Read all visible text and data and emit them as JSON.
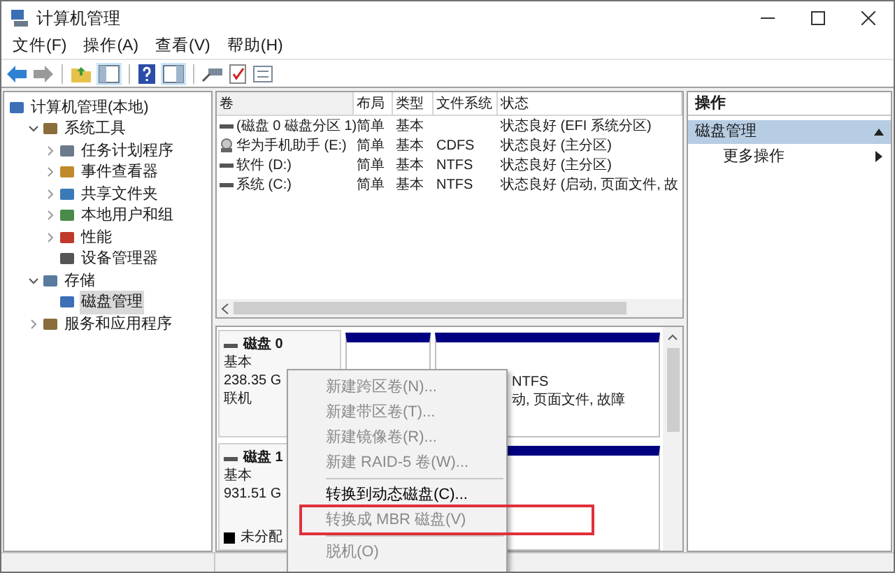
{
  "window": {
    "title": "计算机管理"
  },
  "menu": [
    "文件(F)",
    "操作(A)",
    "查看(V)",
    "帮助(H)"
  ],
  "tree": [
    {
      "label": "计算机管理(本地)",
      "selected": false,
      "children": [
        {
          "label": "系统工具",
          "expanded": true,
          "selected": false,
          "children": [
            {
              "label": "任务计划程序",
              "expanded": false,
              "selected": false
            },
            {
              "label": "事件查看器",
              "expanded": false,
              "selected": false
            },
            {
              "label": "共享文件夹",
              "expanded": false,
              "selected": false
            },
            {
              "label": "本地用户和组",
              "expanded": false,
              "selected": false
            },
            {
              "label": "性能",
              "expanded": false,
              "selected": false
            },
            {
              "label": "设备管理器",
              "selected": false
            }
          ]
        },
        {
          "label": "存储",
          "expanded": true,
          "selected": false,
          "children": [
            {
              "label": "磁盘管理",
              "selected": true
            }
          ]
        },
        {
          "label": "服务和应用程序",
          "expanded": false,
          "selected": false
        }
      ]
    }
  ],
  "volumes": {
    "columns": [
      "卷",
      "布局",
      "类型",
      "文件系统",
      "状态"
    ],
    "rows": [
      {
        "kind": "disk",
        "cells": [
          "(磁盘 0 磁盘分区 1)",
          "简单",
          "基本",
          "",
          "状态良好 (EFI 系统分区)"
        ]
      },
      {
        "kind": "cd",
        "cells": [
          "华为手机助手 (E:)",
          "简单",
          "基本",
          "CDFS",
          "状态良好 (主分区)"
        ]
      },
      {
        "kind": "disk",
        "cells": [
          "软件 (D:)",
          "简单",
          "基本",
          "NTFS",
          "状态良好 (主分区)"
        ]
      },
      {
        "kind": "disk",
        "cells": [
          "系统 (C:)",
          "简单",
          "基本",
          "NTFS",
          "状态良好 (启动, 页面文件, 故"
        ]
      }
    ]
  },
  "disks": [
    {
      "name": "磁盘 0",
      "type": "基本",
      "size": "238.35 G",
      "state": "联机",
      "partition_lines": [
        "NTFS",
        "动, 页面文件, 故障"
      ]
    },
    {
      "name": "磁盘 1",
      "type": "基本",
      "size": "931.51 G",
      "legend": "未分配"
    }
  ],
  "actions": {
    "title": "操作",
    "section": "磁盘管理",
    "items": [
      "更多操作"
    ]
  },
  "context_menu": [
    {
      "label": "新建跨区卷(N)...",
      "disabled": true,
      "highlighted": false
    },
    {
      "label": "新建带区卷(T)...",
      "disabled": true,
      "highlighted": false
    },
    {
      "label": "新建镜像卷(R)...",
      "disabled": true,
      "highlighted": false
    },
    {
      "label": "新建 RAID-5 卷(W)...",
      "disabled": true,
      "highlighted": false,
      "separator_after": true
    },
    {
      "label": "转换到动态磁盘(C)...",
      "disabled": false,
      "highlighted": false
    },
    {
      "label": "转换成 MBR 磁盘(V)",
      "disabled": true,
      "highlighted": true,
      "separator_after": true
    },
    {
      "label": "脱机(O)",
      "disabled": true,
      "highlighted": false
    }
  ]
}
